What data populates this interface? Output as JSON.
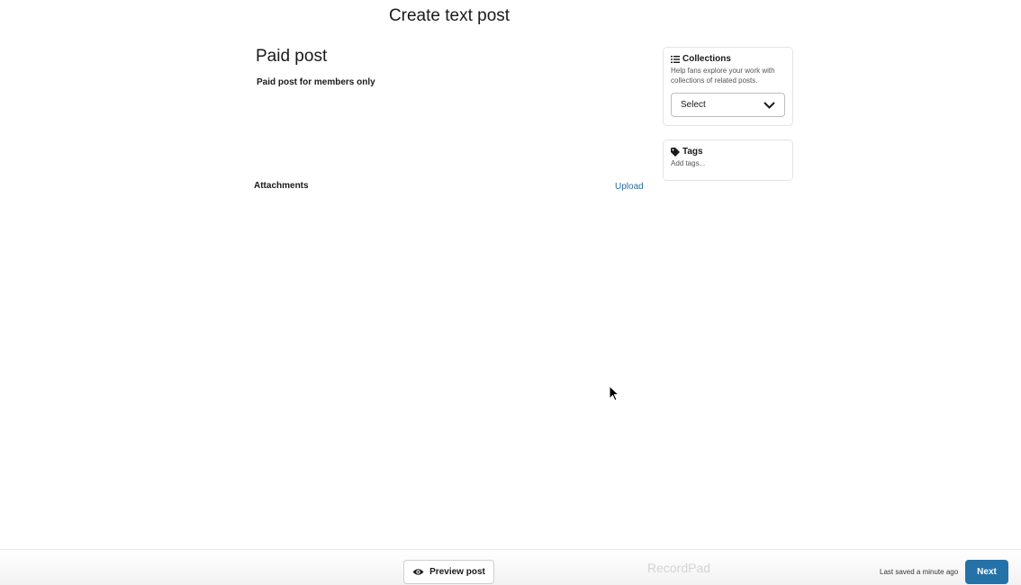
{
  "header": {
    "title": "Create text post"
  },
  "editor": {
    "title": "Paid post",
    "body": "Paid post for members only",
    "attachments_label": "Attachments",
    "upload_label": "Upload"
  },
  "sidebar": {
    "collections": {
      "title": "Collections",
      "description": "Help fans explore your work with collections of related posts.",
      "select_value": "Select",
      "icon": "list-icon"
    },
    "tags": {
      "title": "Tags",
      "placeholder": "Add tags...",
      "icon": "tag-icon"
    }
  },
  "footer": {
    "preview_label": "Preview post",
    "watermark": "RecordPad",
    "last_saved": "Last saved a minute ago",
    "next_label": "Next"
  },
  "colors": {
    "accent": "#2472a8",
    "link": "#2c6e9c"
  }
}
